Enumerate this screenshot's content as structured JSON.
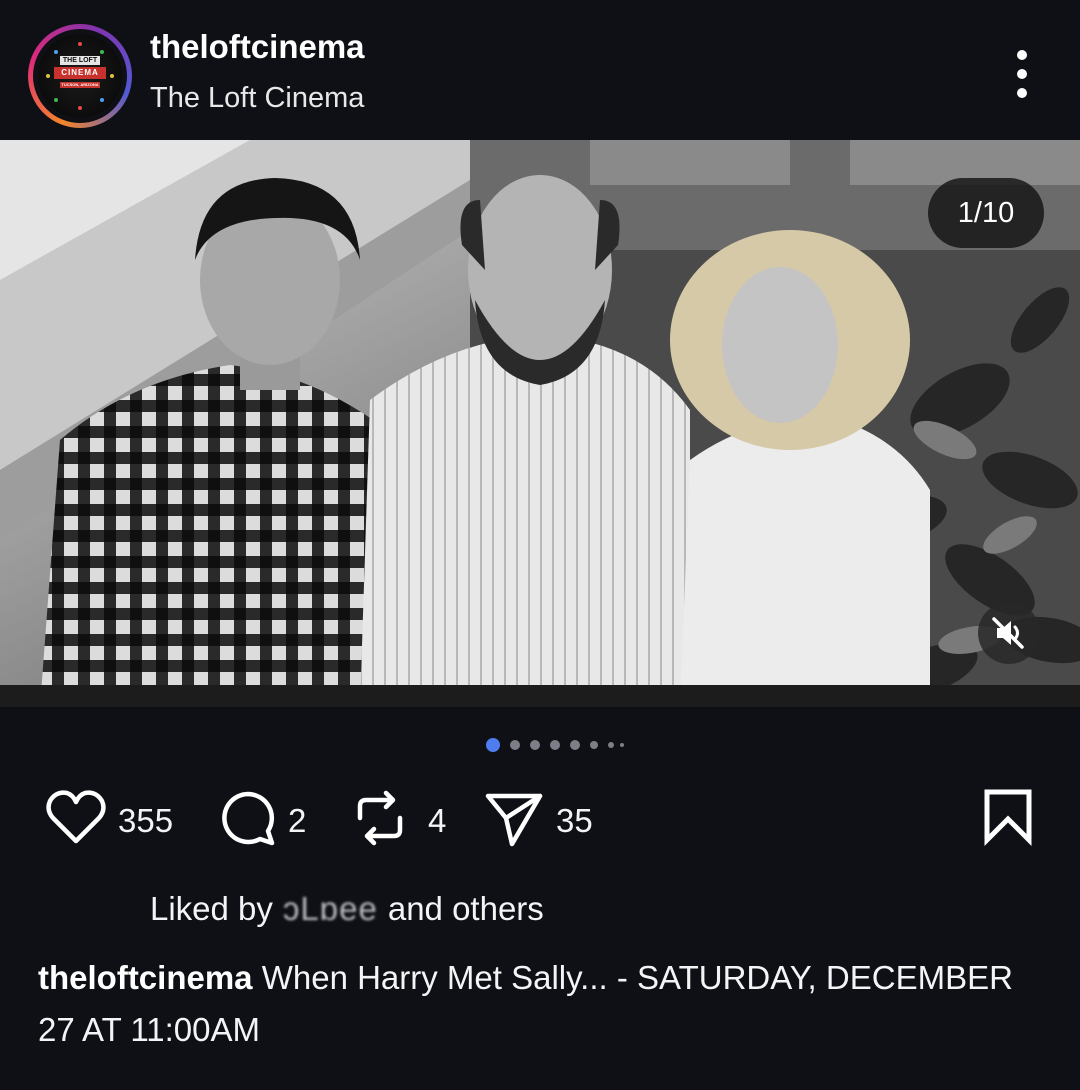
{
  "post": {
    "username": "theloftcinema",
    "display_name": "The Loft Cinema",
    "avatar_text_top": "THE LOFT",
    "avatar_text_mid": "CINEMA",
    "avatar_text_bottom": "TUCSON, ARIZONA",
    "slide_counter": "1/10",
    "carousel": {
      "total_dots": 8,
      "active_index": 0
    },
    "actions": {
      "likes": "355",
      "comments": "2",
      "reposts": "4",
      "shares": "35"
    },
    "liked_by": {
      "prefix": "Liked by",
      "user": "ɔLɒee",
      "suffix": "and others"
    },
    "caption": {
      "username": "theloftcinema",
      "text": "When Harry Met Sally... - SATURDAY, DECEMBER 27 AT 11:00AM"
    }
  },
  "icons": {
    "more": "more-vertical-icon",
    "mute": "muted-speaker-icon",
    "like": "heart-icon",
    "comment": "comment-icon",
    "repost": "repost-icon",
    "share": "paper-plane-icon",
    "save": "bookmark-icon"
  },
  "colors": {
    "background": "#0e1015",
    "active_dot": "#4f7df0",
    "inactive_dot": "#7c7f87",
    "text": "#f3f4f6"
  }
}
